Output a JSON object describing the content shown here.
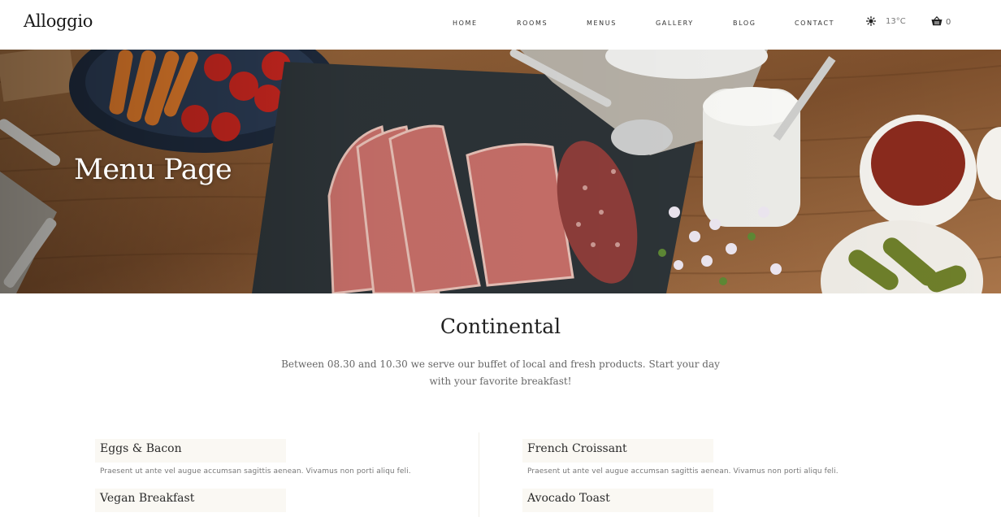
{
  "header": {
    "logo": "Alloggio",
    "nav": [
      "HOME",
      "ROOMS",
      "MENUS",
      "GALLERY",
      "BLOG",
      "CONTACT"
    ],
    "weather_icon": "sun-icon",
    "temperature": "13°C",
    "cart_icon": "basket-icon",
    "cart_count": "0"
  },
  "hero": {
    "title": "Menu Page"
  },
  "section": {
    "title": "Continental",
    "description": "Between 08.30 and 10.30 we serve our buffet of local and fresh products. Start your day with your favorite breakfast!"
  },
  "menu": {
    "left": [
      {
        "name": "Eggs & Bacon",
        "desc": "Praesent ut ante vel augue accumsan sagittis aenean. Vivamus non porti aliqu feli."
      },
      {
        "name": "Vegan Breakfast",
        "desc": ""
      }
    ],
    "right": [
      {
        "name": "French Croissant",
        "desc": "Praesent ut ante vel augue accumsan sagittis aenean. Vivamus non porti aliqu feli."
      },
      {
        "name": "Avocado Toast",
        "desc": ""
      }
    ]
  },
  "colors": {
    "accent_bg": "#faf8f3",
    "wood": "#8a5a33",
    "slate": "#2d3438"
  }
}
